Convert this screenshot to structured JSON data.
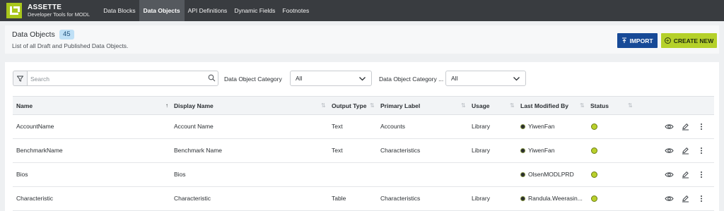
{
  "app": {
    "name": "ASSETTE",
    "subtitle": "Developer Tools for MODL"
  },
  "nav": {
    "tabs": [
      {
        "label": "Data Blocks",
        "active": false
      },
      {
        "label": "Data Objects",
        "active": true
      },
      {
        "label": "API Definitions",
        "active": false
      },
      {
        "label": "Dynamic Fields",
        "active": false
      },
      {
        "label": "Footnotes",
        "active": false
      }
    ]
  },
  "header": {
    "title": "Data Objects",
    "count": "45",
    "subtitle": "List of all Draft and Published Data Objects.",
    "import_label": "IMPORT",
    "create_label": "CREATE NEW"
  },
  "filters": {
    "search_placeholder": "Search",
    "search_value": "",
    "category_label": "Data Object Category",
    "category_value": "All",
    "category2_label": "Data Object Category ...",
    "category2_value": "All"
  },
  "table": {
    "columns": [
      "Name",
      "Display Name",
      "Output Type",
      "Primary Label",
      "Usage",
      "Last Modified By",
      "Status"
    ],
    "rows": [
      {
        "name": "AccountName",
        "display_name": "Account Name",
        "output_type": "Text",
        "primary_label": "Accounts",
        "usage": "Library",
        "modified_by": "YiwenFan",
        "status": "published"
      },
      {
        "name": "BenchmarkName",
        "display_name": "Benchmark Name",
        "output_type": "Text",
        "primary_label": "Characteristics",
        "usage": "Library",
        "modified_by": "YiwenFan",
        "status": "published"
      },
      {
        "name": "Bios",
        "display_name": "Bios",
        "output_type": "",
        "primary_label": "",
        "usage": "",
        "modified_by": "OlsenMODLPRD",
        "status": "published"
      },
      {
        "name": "Characteristic",
        "display_name": "Characteristic",
        "output_type": "Table",
        "primary_label": "Characteristics",
        "usage": "Library",
        "modified_by": "Randula.Weerasin...",
        "status": "published"
      }
    ]
  },
  "colors": {
    "nav_bg": "#393c40",
    "brand_green": "#a9c71c",
    "import_blue": "#174a97",
    "create_green": "#b5d12a",
    "status_green": "#b9d02b"
  }
}
